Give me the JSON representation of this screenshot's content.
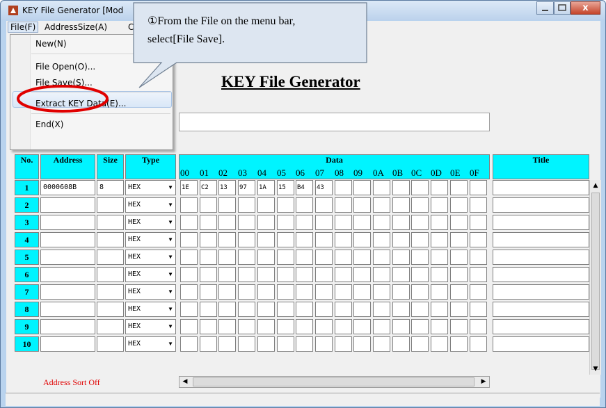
{
  "window": {
    "title": "KEY File Generator [Mod",
    "controls": {
      "close": "x"
    }
  },
  "menubar": {
    "items": [
      "File(F)",
      "AddressSize(A)",
      "C"
    ]
  },
  "file_menu": {
    "items": [
      "New(N)",
      "File Open(O)...",
      "File Save(S)...",
      "Extract KEY Data(E)...",
      "End(X)"
    ],
    "highlighted": "File Save(S)..."
  },
  "main_title": "KEY File Generator",
  "table": {
    "headers": {
      "no": "No.",
      "address": "Address",
      "size": "Size",
      "type": "Type",
      "data": "Data",
      "title": "Title"
    },
    "hex_columns": [
      "00",
      "01",
      "02",
      "03",
      "04",
      "05",
      "06",
      "07",
      "08",
      "09",
      "0A",
      "0B",
      "0C",
      "0D",
      "0E",
      "0F"
    ],
    "rows": [
      {
        "no": "1",
        "address": "0000608B",
        "size": "8",
        "type": "HEX",
        "data": [
          "1E",
          "C2",
          "13",
          "97",
          "1A",
          "15",
          "B4",
          "43",
          "",
          "",
          "",
          "",
          "",
          "",
          "",
          ""
        ],
        "title": ""
      },
      {
        "no": "2",
        "address": "",
        "size": "",
        "type": "HEX",
        "data": [
          "",
          "",
          "",
          "",
          "",
          "",
          "",
          "",
          "",
          "",
          "",
          "",
          "",
          "",
          "",
          ""
        ],
        "title": ""
      },
      {
        "no": "3",
        "address": "",
        "size": "",
        "type": "HEX",
        "data": [
          "",
          "",
          "",
          "",
          "",
          "",
          "",
          "",
          "",
          "",
          "",
          "",
          "",
          "",
          "",
          ""
        ],
        "title": ""
      },
      {
        "no": "4",
        "address": "",
        "size": "",
        "type": "HEX",
        "data": [
          "",
          "",
          "",
          "",
          "",
          "",
          "",
          "",
          "",
          "",
          "",
          "",
          "",
          "",
          "",
          ""
        ],
        "title": ""
      },
      {
        "no": "5",
        "address": "",
        "size": "",
        "type": "HEX",
        "data": [
          "",
          "",
          "",
          "",
          "",
          "",
          "",
          "",
          "",
          "",
          "",
          "",
          "",
          "",
          "",
          ""
        ],
        "title": ""
      },
      {
        "no": "6",
        "address": "",
        "size": "",
        "type": "HEX",
        "data": [
          "",
          "",
          "",
          "",
          "",
          "",
          "",
          "",
          "",
          "",
          "",
          "",
          "",
          "",
          "",
          ""
        ],
        "title": ""
      },
      {
        "no": "7",
        "address": "",
        "size": "",
        "type": "HEX",
        "data": [
          "",
          "",
          "",
          "",
          "",
          "",
          "",
          "",
          "",
          "",
          "",
          "",
          "",
          "",
          "",
          ""
        ],
        "title": ""
      },
      {
        "no": "8",
        "address": "",
        "size": "",
        "type": "HEX",
        "data": [
          "",
          "",
          "",
          "",
          "",
          "",
          "",
          "",
          "",
          "",
          "",
          "",
          "",
          "",
          "",
          ""
        ],
        "title": ""
      },
      {
        "no": "9",
        "address": "",
        "size": "",
        "type": "HEX",
        "data": [
          "",
          "",
          "",
          "",
          "",
          "",
          "",
          "",
          "",
          "",
          "",
          "",
          "",
          "",
          "",
          ""
        ],
        "title": ""
      },
      {
        "no": "10",
        "address": "",
        "size": "",
        "type": "HEX",
        "data": [
          "",
          "",
          "",
          "",
          "",
          "",
          "",
          "",
          "",
          "",
          "",
          "",
          "",
          "",
          "",
          ""
        ],
        "title": ""
      }
    ]
  },
  "address_sort": "Address Sort Off",
  "callout": {
    "line1": "①From the File on the menu bar,",
    "line2": "select[File Save]."
  },
  "colors": {
    "header_bg": "#00f4ff",
    "highlight_circle": "#e00000",
    "sort_text": "#e00000"
  },
  "icons": {
    "app": "app-icon",
    "dropdown_arrow": "chevron-down-icon"
  }
}
